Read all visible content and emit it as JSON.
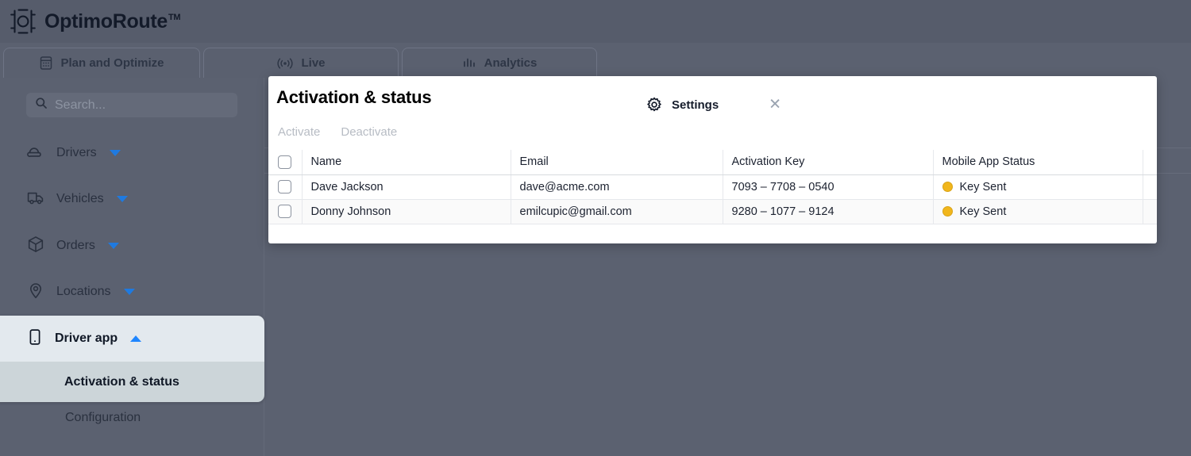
{
  "brand": {
    "name": "OptimoRoute",
    "trademark": "TM",
    "logo_icon": "optimoroute-logo-icon"
  },
  "tabs": [
    {
      "id": "plan",
      "label": "Plan and Optimize",
      "icon": "calendar-icon",
      "active": false
    },
    {
      "id": "live",
      "label": "Live",
      "icon": "broadcast-icon",
      "active": false
    },
    {
      "id": "analytics",
      "label": "Analytics",
      "icon": "bar-chart-icon",
      "active": false
    },
    {
      "id": "settings",
      "label": "Settings",
      "icon": "gear-icon",
      "active": true,
      "close_label": "✕"
    }
  ],
  "sidebar": {
    "search": {
      "placeholder": "Search...",
      "value": "",
      "icon": "search-icon"
    },
    "items": [
      {
        "id": "drivers",
        "label": "Drivers",
        "icon": "driver-cap-icon",
        "caret": "down"
      },
      {
        "id": "vehicles",
        "label": "Vehicles",
        "icon": "truck-icon",
        "caret": "down"
      },
      {
        "id": "orders",
        "label": "Orders",
        "icon": "package-icon",
        "caret": "down"
      },
      {
        "id": "locations",
        "label": "Locations",
        "icon": "map-pin-icon",
        "caret": "down"
      },
      {
        "id": "driver-app",
        "label": "Driver app",
        "icon": "mobile-phone-icon",
        "caret": "up"
      }
    ],
    "sub_items": [
      {
        "id": "activation-status",
        "label": "Activation & status",
        "selected": true
      },
      {
        "id": "configuration",
        "label": "Configuration",
        "selected": false
      }
    ]
  },
  "panel": {
    "title": "Activation & status",
    "actions": [
      {
        "id": "activate",
        "label": "Activate",
        "disabled": true
      },
      {
        "id": "deactivate",
        "label": "Deactivate",
        "disabled": true
      }
    ],
    "table": {
      "columns": [
        "",
        "Name",
        "Email",
        "Activation Key",
        "Mobile App Status"
      ],
      "rows": [
        {
          "checked": false,
          "name": "Dave Jackson",
          "email": "dave@acme.com",
          "activation_key": "7093 – 7708 – 0540",
          "status": "Key Sent",
          "status_color": "#f1b61c"
        },
        {
          "checked": false,
          "name": "Donny Johnson",
          "email": "emilcupic@gmail.com",
          "activation_key": "9280 – 1077 – 9124",
          "status": "Key Sent",
          "status_color": "#f1b61c"
        }
      ]
    }
  },
  "colors": {
    "app_background": "#5b6170",
    "panel_background": "#ffffff",
    "accent_blue": "#1f86ff",
    "status_amber": "#f1b61c",
    "selected_nav": "#ccd5d9"
  }
}
